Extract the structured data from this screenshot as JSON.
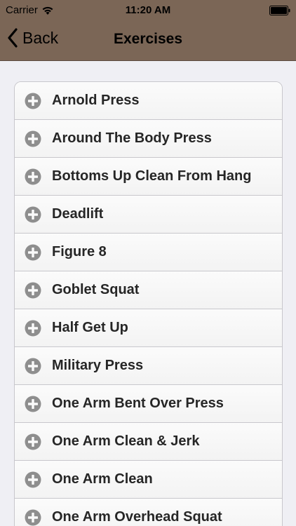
{
  "status_bar": {
    "carrier": "Carrier",
    "time": "11:20 AM"
  },
  "nav": {
    "back_label": "Back",
    "title": "Exercises",
    "color": "#7b6656"
  },
  "exercises": [
    {
      "label": "Arnold Press",
      "icon": "plus-circle-icon"
    },
    {
      "label": "Around The Body Press",
      "icon": "plus-circle-icon"
    },
    {
      "label": "Bottoms Up Clean From Hang",
      "icon": "plus-circle-icon"
    },
    {
      "label": "Deadlift",
      "icon": "plus-circle-icon"
    },
    {
      "label": "Figure 8",
      "icon": "plus-circle-icon"
    },
    {
      "label": "Goblet Squat",
      "icon": "plus-circle-icon"
    },
    {
      "label": "Half Get Up",
      "icon": "plus-circle-icon"
    },
    {
      "label": "Military Press",
      "icon": "plus-circle-icon"
    },
    {
      "label": "One Arm Bent Over Press",
      "icon": "plus-circle-icon"
    },
    {
      "label": "One Arm Clean & Jerk",
      "icon": "plus-circle-icon"
    },
    {
      "label": "One Arm Clean",
      "icon": "plus-circle-icon"
    },
    {
      "label": "One Arm Overhead Squat",
      "icon": "plus-circle-icon"
    }
  ]
}
